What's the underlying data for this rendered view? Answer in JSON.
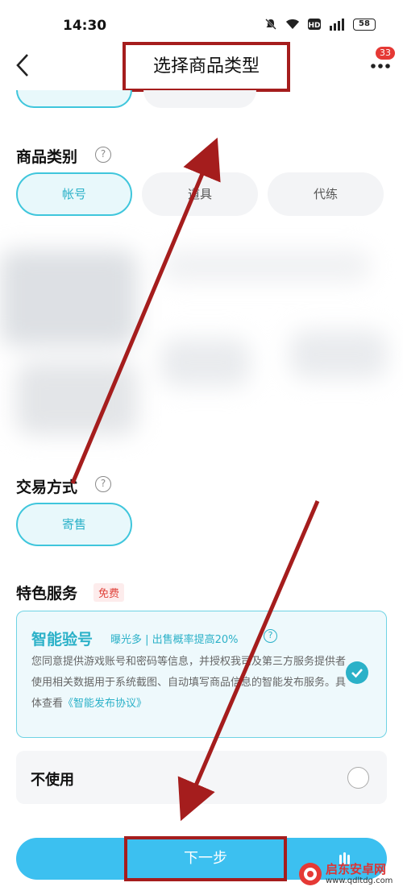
{
  "status": {
    "time": "14:30",
    "battery": "58"
  },
  "nav": {
    "title": "选择商品类型",
    "badge_count": "33"
  },
  "category": {
    "label": "商品类别",
    "chips": [
      {
        "label": "帐号",
        "active": true
      },
      {
        "label": "道具",
        "active": false
      },
      {
        "label": "代练",
        "active": false
      }
    ]
  },
  "trade": {
    "label": "交易方式",
    "chips": [
      {
        "label": "寄售",
        "active": true
      }
    ]
  },
  "services": {
    "label": "特色服务",
    "free_tag": "免费",
    "smart": {
      "title": "智能验号",
      "subtitle": "曝光多 | 出售概率提高20%",
      "description": "您同意提供游戏账号和密码等信息，并授权我司及第三方服务提供者使用相关数据用于系统截图、自动填写商品信息的智能发布服务。具体查看",
      "link_text": "《智能发布协议》",
      "selected": true
    },
    "no_use": {
      "label": "不使用",
      "selected": false
    }
  },
  "next_button": {
    "label": "下一步"
  },
  "watermark": {
    "title": "启东安卓网",
    "url": "www.qdltdg.com"
  },
  "colors": {
    "accent": "#2bb1c8",
    "primary_button": "#3cc0f0",
    "annotation": "#a51d1d"
  }
}
